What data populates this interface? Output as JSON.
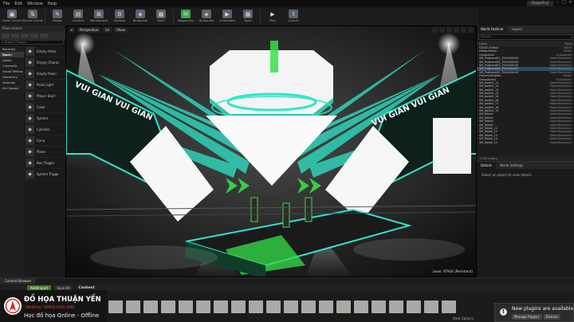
{
  "menu": [
    "File",
    "Edit",
    "Window",
    "Help"
  ],
  "window_title": "StageProj",
  "toolbar": [
    {
      "label": "Save Current",
      "icon": "save-icon"
    },
    {
      "label": "Source Control",
      "icon": "source-control-icon"
    },
    {
      "label": "Modes",
      "icon": "modes-icon"
    },
    {
      "label": "Content",
      "icon": "content-icon"
    },
    {
      "label": "Marketplace",
      "icon": "marketplace-icon"
    },
    {
      "label": "Settings",
      "icon": "settings-icon"
    },
    {
      "label": "Blueprints",
      "icon": "blueprints-icon"
    },
    {
      "label": "Build",
      "icon": "build-icon"
    },
    {
      "label": "Megascans",
      "icon": "megascans-icon"
    },
    {
      "label": "Blueprints",
      "icon": "blueprints2-icon"
    },
    {
      "label": "Cinematics",
      "icon": "cinematics-icon"
    },
    {
      "label": "Build",
      "icon": "build2-icon"
    },
    {
      "label": "Play",
      "icon": "play-icon"
    },
    {
      "label": "Launch",
      "icon": "launch-icon"
    }
  ],
  "modes_panel": {
    "title": "Place Actors",
    "search_placeholder": "Search Classes",
    "categories": [
      "Recently Placed",
      "Basic",
      "Lights",
      "Cinematic",
      "Visual Effects",
      "Geometry",
      "Volumes",
      "All Classes"
    ],
    "active_category": "Basic",
    "assets": [
      {
        "label": "Empty Actor",
        "icon": "actor-icon"
      },
      {
        "label": "Empty Charac",
        "icon": "character-icon"
      },
      {
        "label": "Empty Pawn",
        "icon": "pawn-icon"
      },
      {
        "label": "Point Light",
        "icon": "light-icon"
      },
      {
        "label": "Player Start",
        "icon": "player-start-icon"
      },
      {
        "label": "Cube",
        "icon": "cube-icon"
      },
      {
        "label": "Sphere",
        "icon": "sphere-icon"
      },
      {
        "label": "Cylinder",
        "icon": "cylinder-icon"
      },
      {
        "label": "Cone",
        "icon": "cone-icon"
      },
      {
        "label": "Plane",
        "icon": "plane-icon"
      },
      {
        "label": "Box Trigger",
        "icon": "box-trigger-icon"
      },
      {
        "label": "Sphere Trigge",
        "icon": "sphere-trigger-icon"
      }
    ]
  },
  "viewport": {
    "buttons": [
      "Perspective",
      "Lit",
      "Show"
    ],
    "level_label": "Level: STAGE (Persistent)",
    "banner_text_left": "VUI GIAN  VUI GIAN",
    "banner_text_right": "VUI GIAN  VUI GIAN"
  },
  "world_outliner": {
    "tabs": [
      "World Outliner",
      "Layers"
    ],
    "search_placeholder": "Search...",
    "col_label": "Label",
    "col_type": "Type",
    "rows": [
      {
        "label": "STAGE (Editor)",
        "type": "World",
        "selected": false
      },
      {
        "label": "DesignFolder",
        "type": "Folder",
        "selected": false
      },
      {
        "label": "GroupActor",
        "type": "GroupActor",
        "selected": false
      },
      {
        "label": "SM_ProBoard01_700x500x35",
        "type": "StaticMeshActor",
        "selected": false
      },
      {
        "label": "SM_ProBoard02_700x500x35",
        "type": "StaticMeshActor",
        "selected": false
      },
      {
        "label": "SM_ProBoard03_700x500x35",
        "type": "StaticMeshActor",
        "selected": false
      },
      {
        "label": "SM_ProBoard04_700x500x35",
        "type": "StaticMeshActor",
        "selected": true
      },
      {
        "label": "SM_ProBoard05_700x500x35",
        "type": "StaticMeshActor",
        "selected": false
      },
      {
        "label": "ProjectionFolder",
        "type": "Folder",
        "selected": false
      },
      {
        "label": "GroupActor2",
        "type": "GroupActor",
        "selected": false
      },
      {
        "label": "SM_ballet1_11",
        "type": "StaticMeshActor",
        "selected": false
      },
      {
        "label": "SM_ballet1_12",
        "type": "StaticMeshActor",
        "selected": false
      },
      {
        "label": "SM_ballet1_13",
        "type": "StaticMeshActor",
        "selected": false
      },
      {
        "label": "SM_ballet1_14",
        "type": "StaticMeshActor",
        "selected": false
      },
      {
        "label": "SM_ballet1_15",
        "type": "StaticMeshActor",
        "selected": false
      },
      {
        "label": "SM_ballet1_16",
        "type": "StaticMeshActor",
        "selected": false
      },
      {
        "label": "SM_ballet1_17",
        "type": "StaticMeshActor",
        "selected": false
      },
      {
        "label": "SM_ballet1_18",
        "type": "StaticMeshActor",
        "selected": false
      },
      {
        "label": "SM_ballet1_19",
        "type": "StaticMeshActor",
        "selected": false
      },
      {
        "label": "SM_Table1",
        "type": "StaticMeshActor",
        "selected": false
      },
      {
        "label": "SM_Table2",
        "type": "StaticMeshActor",
        "selected": false
      },
      {
        "label": "SM_Table3",
        "type": "StaticMeshActor",
        "selected": false
      },
      {
        "label": "SM_Table4",
        "type": "StaticMeshActor",
        "selected": false
      },
      {
        "label": "SM_Tablet_11",
        "type": "StaticMeshActor",
        "selected": false
      },
      {
        "label": "SM_Tablet_12",
        "type": "StaticMeshActor",
        "selected": false
      },
      {
        "label": "SM_Tablet_13",
        "type": "StaticMeshActor",
        "selected": false
      },
      {
        "label": "SM_Tablet_14",
        "type": "StaticMeshActor",
        "selected": false
      },
      {
        "label": "SM_Tablet_15",
        "type": "StaticMeshActor",
        "selected": false
      }
    ],
    "footer": "7,284 actors"
  },
  "details": {
    "tabs": [
      "Details",
      "World Settings"
    ],
    "message": "Select an object to view details."
  },
  "content_browser": {
    "tab": "Content Browser",
    "add_label": "Add/Import",
    "save_label": "Save All",
    "path": "Content",
    "view_options": "View Options",
    "folder_count": 20
  },
  "watermark": {
    "line1": "ĐỒ HỌA THUẬN YẾN",
    "line2": "Hotline: 0000.000.000",
    "line3": "Học đồ họa Online - Offline"
  },
  "notification": {
    "title": "New plugins are available",
    "manage_label": "Manage Plugins",
    "dismiss_label": "Dismiss"
  },
  "colors": {
    "accent_cyan": "#2ee6c8",
    "accent_green": "#35e04a",
    "selection_blue": "#2f4a66",
    "add_button_green": "#3c7d28"
  }
}
